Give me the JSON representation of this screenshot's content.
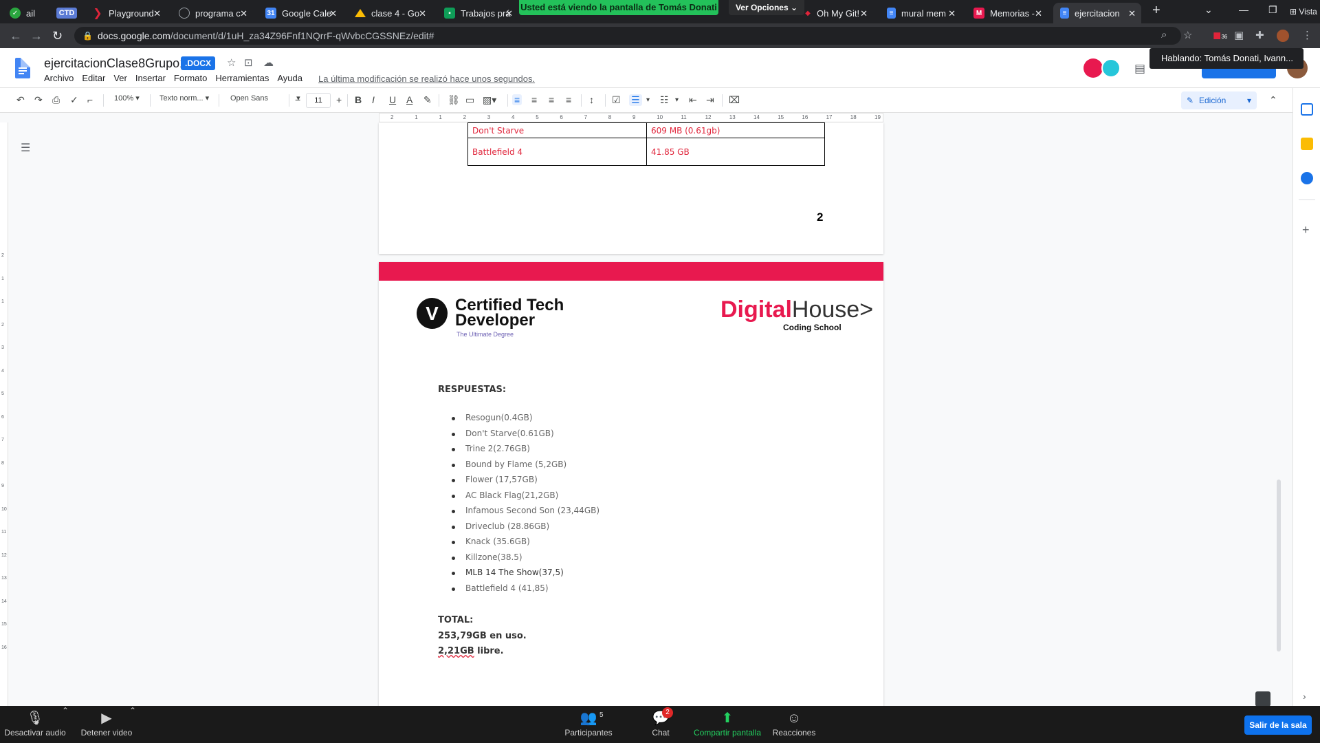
{
  "browser": {
    "tabs": [
      {
        "label": "ail",
        "icon": "shield-icon",
        "icon_color": "#2aa63f"
      },
      {
        "label": "CTD",
        "icon": "ctd-badge-icon",
        "icon_color": "#5b7bd5"
      },
      {
        "label": "Playground",
        "icon": "play-icon",
        "icon_color": "#e0243a"
      },
      {
        "label": "programa c",
        "icon": "globe-icon",
        "icon_color": "#9aa0a6"
      },
      {
        "label": "Google Cale",
        "icon": "calendar-icon",
        "icon_color": "#4285f4"
      },
      {
        "label": "clase 4 - Go",
        "icon": "drive-icon",
        "icon_color": "#fbbc04"
      },
      {
        "label": "Trabajos prá",
        "icon": "classroom-icon",
        "icon_color": "#0f9d58"
      },
      {
        "label": "Oh My Git!",
        "icon": "git-icon",
        "icon_color": "#e0243a"
      },
      {
        "label": "mural mem",
        "icon": "docs-icon",
        "icon_color": "#4285f4"
      },
      {
        "label": "Memorias -",
        "icon": "m-icon",
        "icon_color": "#e8194f"
      },
      {
        "label": "ejercitacion",
        "icon": "docs-icon",
        "icon_color": "#4285f4",
        "active": true
      }
    ],
    "new_tab": "+",
    "share_banner": "Usted está viendo la pantalla de Tomás Donati",
    "view_options": "Ver Opciones",
    "window_label": "Vista",
    "url_host": "docs.google.com",
    "url_path": "/document/d/1uH_za34Z96Fnf1NQrrF-qWvbcCGSSNEz/edit#",
    "extension_badge": "36"
  },
  "docs": {
    "title": "ejercitacionClase8Grupo1",
    "format_badge": ".DOCX",
    "menu": [
      "Archivo",
      "Editar",
      "Ver",
      "Insertar",
      "Formato",
      "Herramientas",
      "Ayuda"
    ],
    "last_edit": "La última modificación se realizó hace unos segundos.",
    "speaking_tooltip": "Hablando: Tomás Donati, Ivann...",
    "toolbar": {
      "zoom": "100%",
      "style": "Texto norm...",
      "font": "Open Sans",
      "font_size": "11",
      "mode": "Edición"
    }
  },
  "ruler_labels": [
    "2",
    "1",
    "1",
    "2",
    "3",
    "4",
    "5",
    "6",
    "7",
    "8",
    "9",
    "10",
    "11",
    "12",
    "13",
    "14",
    "15",
    "16",
    "17",
    "18",
    "19"
  ],
  "vertical_ruler_labels": [
    "2",
    "1",
    "1",
    "2",
    "3",
    "4",
    "5",
    "6",
    "7",
    "8",
    "9",
    "10",
    "11",
    "12",
    "13",
    "14",
    "15",
    "16"
  ],
  "table_rows": [
    {
      "game": "Don't Starve",
      "size": "609 MB (0.61gb)"
    },
    {
      "game": "Battlefield 4",
      "size": "41.85 GB"
    }
  ],
  "page_number": "2",
  "header_logos": {
    "ctd_mark": "V",
    "ctd_name_line1": "Certified Tech",
    "ctd_name_line2": "Developer",
    "ctd_tagline": "The Ultimate Degree",
    "dh_part1": "Digital",
    "dh_part2": "House",
    "dh_arrow": ">",
    "dh_sub": "Coding School"
  },
  "answers_heading": "RESPUESTAS:",
  "answers": [
    "Resogun(0.4GB)",
    "Don't Starve(0.61GB)",
    "Trine 2(2.76GB)",
    "Bound by Flame (5,2GB)",
    "Flower (17,57GB)",
    "AC Black Flag(21,2GB)",
    "Infamous Second Son (23,44GB)",
    "Driveclub (28.86GB)",
    "Knack (35.6GB)",
    "Killzone(38.5)",
    "MLB 14 The Show(37,5)",
    "Battlefield 4 (41,85)"
  ],
  "total_heading": "TOTAL:",
  "in_use": "253,79GB en uso.",
  "free_amount": "2,21GB",
  "free_suffix": " libre.",
  "zoom": {
    "mute": "Desactivar audio",
    "video": "Detener video",
    "participants": "Participantes",
    "participants_count": "5",
    "chat": "Chat",
    "chat_badge": "2",
    "share": "Compartir pantalla",
    "reactions": "Reacciones",
    "leave": "Salir de la sala"
  },
  "colors": {
    "accent_red": "#e0243a",
    "brand_pink": "#e8194f",
    "docs_blue": "#1a73e8",
    "zoom_green": "#23c15a",
    "zoom_blue": "#0e72ed"
  }
}
